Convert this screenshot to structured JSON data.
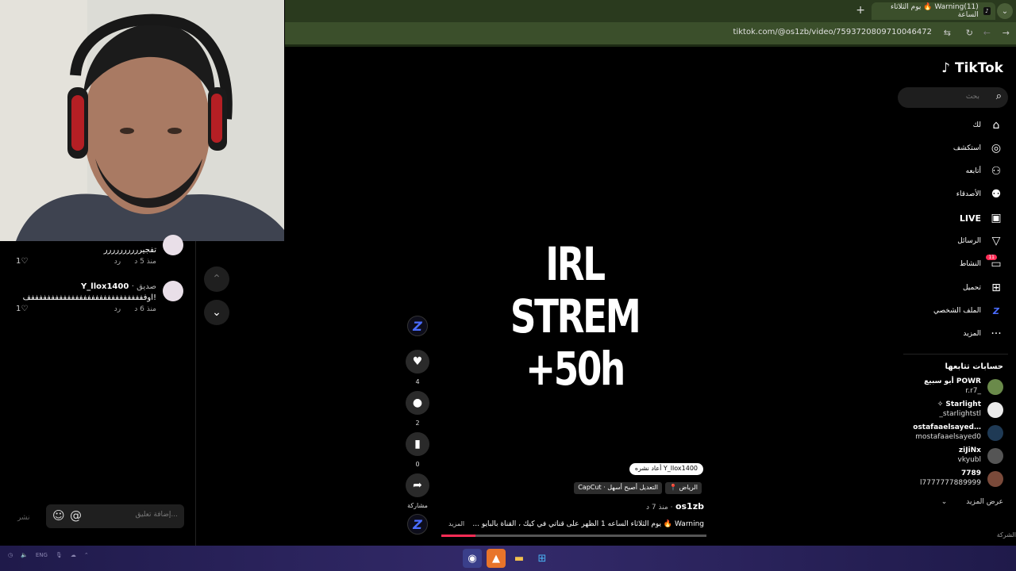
{
  "browser": {
    "tab_title": "Warning(11) 🔥 يوم الثلاثاء الساعة",
    "url": "tiktok.com/@os1zb/video/7593720809710046472"
  },
  "comments": {
    "items": [
      {
        "name": "",
        "text": "تفجيرررررررررر",
        "time": "منذ 5 د",
        "reply": "رد",
        "likes": "1"
      },
      {
        "name": "Y_llox1400",
        "badge": "· صديق",
        "text": "اوفففففففففففففففففففففففففففففف!",
        "time": "منذ 6 د",
        "reply": "رد",
        "likes": "1"
      }
    ],
    "input_placeholder": "إضافة تعليق...",
    "post_label": "نشر"
  },
  "video": {
    "overlay_lines": [
      "IRL",
      "STREM",
      "+50h"
    ],
    "repost": "Y_llox1400 أعاد نشره",
    "location": "الرياض",
    "capcut": "CapCut · التعديل أصبح أسهل",
    "author": "os1zb",
    "posted": "منذ 7 د",
    "description": "Warning 🔥 يوم الثلاثاء الساعه 1 الظهر على قناتي في كيك ، القناة بالبايو ...",
    "more": "المزيد",
    "progress": 0.13
  },
  "actions": {
    "likes": "4",
    "comments": "2",
    "saves": "0",
    "share": "مشاركة"
  },
  "sidebar": {
    "logo": "TikTok",
    "search_placeholder": "بحث",
    "menu": [
      {
        "label": "لك",
        "icon": "home-icon"
      },
      {
        "label": "استكشف",
        "icon": "compass-icon"
      },
      {
        "label": "أتابعه",
        "icon": "following-icon"
      },
      {
        "label": "الأصدقاء",
        "icon": "friends-icon"
      },
      {
        "label": "LIVE",
        "icon": "live-icon"
      },
      {
        "label": "الرسائل",
        "icon": "messages-icon"
      },
      {
        "label": "النشاط",
        "icon": "activity-icon",
        "badge": "11"
      },
      {
        "label": "تحميل",
        "icon": "upload-icon"
      },
      {
        "label": "الملف الشخصي",
        "icon": "profile-icon"
      },
      {
        "label": "المزيد",
        "icon": "more-icon"
      }
    ],
    "following_title": "حسابات تتابعها",
    "accounts": [
      {
        "name": "أبو سبيع POWR",
        "handle": "r.r7_"
      },
      {
        "name": "✧ Starlight",
        "handle": "_starlightstl"
      },
      {
        "name": "ostafaaelsayed…",
        "handle": "mostafaaelsayed0"
      },
      {
        "name": "ziJiNx",
        "handle": "vkyubl"
      },
      {
        "name": "7789",
        "handle": "l7777777889999"
      }
    ],
    "show_more": "عرض المزيد",
    "company": "الشركة"
  },
  "taskbar": {
    "lang": "ENG"
  }
}
